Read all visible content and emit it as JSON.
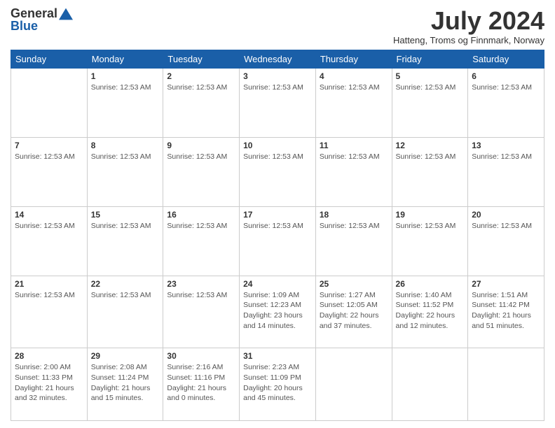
{
  "logo": {
    "line1": "General",
    "line2": "Blue"
  },
  "title": "July 2024",
  "location": "Hatteng, Troms og Finnmark, Norway",
  "days_of_week": [
    "Sunday",
    "Monday",
    "Tuesday",
    "Wednesday",
    "Thursday",
    "Friday",
    "Saturday"
  ],
  "weeks": [
    [
      {
        "day": "",
        "info": ""
      },
      {
        "day": "1",
        "info": "Sunrise: 12:53 AM"
      },
      {
        "day": "2",
        "info": "Sunrise: 12:53 AM"
      },
      {
        "day": "3",
        "info": "Sunrise: 12:53 AM"
      },
      {
        "day": "4",
        "info": "Sunrise: 12:53 AM"
      },
      {
        "day": "5",
        "info": "Sunrise: 12:53 AM"
      },
      {
        "day": "6",
        "info": "Sunrise: 12:53 AM"
      }
    ],
    [
      {
        "day": "7",
        "info": "Sunrise: 12:53 AM"
      },
      {
        "day": "8",
        "info": "Sunrise: 12:53 AM"
      },
      {
        "day": "9",
        "info": "Sunrise: 12:53 AM"
      },
      {
        "day": "10",
        "info": "Sunrise: 12:53 AM"
      },
      {
        "day": "11",
        "info": "Sunrise: 12:53 AM"
      },
      {
        "day": "12",
        "info": "Sunrise: 12:53 AM"
      },
      {
        "day": "13",
        "info": "Sunrise: 12:53 AM"
      }
    ],
    [
      {
        "day": "14",
        "info": "Sunrise: 12:53 AM"
      },
      {
        "day": "15",
        "info": "Sunrise: 12:53 AM"
      },
      {
        "day": "16",
        "info": "Sunrise: 12:53 AM"
      },
      {
        "day": "17",
        "info": "Sunrise: 12:53 AM"
      },
      {
        "day": "18",
        "info": "Sunrise: 12:53 AM"
      },
      {
        "day": "19",
        "info": "Sunrise: 12:53 AM"
      },
      {
        "day": "20",
        "info": "Sunrise: 12:53 AM"
      }
    ],
    [
      {
        "day": "21",
        "info": "Sunrise: 12:53 AM"
      },
      {
        "day": "22",
        "info": "Sunrise: 12:53 AM"
      },
      {
        "day": "23",
        "info": "Sunrise: 12:53 AM"
      },
      {
        "day": "24",
        "info": "Sunrise: 1:09 AM\nSunset: 12:23 AM\nDaylight: 23 hours and 14 minutes."
      },
      {
        "day": "25",
        "info": "Sunrise: 1:27 AM\nSunset: 12:05 AM\nDaylight: 22 hours and 37 minutes."
      },
      {
        "day": "26",
        "info": "Sunrise: 1:40 AM\nSunset: 11:52 PM\nDaylight: 22 hours and 12 minutes."
      },
      {
        "day": "27",
        "info": "Sunrise: 1:51 AM\nSunset: 11:42 PM\nDaylight: 21 hours and 51 minutes."
      }
    ],
    [
      {
        "day": "28",
        "info": "Sunrise: 2:00 AM\nSunset: 11:33 PM\nDaylight: 21 hours and 32 minutes."
      },
      {
        "day": "29",
        "info": "Sunrise: 2:08 AM\nSunset: 11:24 PM\nDaylight: 21 hours and 15 minutes."
      },
      {
        "day": "30",
        "info": "Sunrise: 2:16 AM\nSunset: 11:16 PM\nDaylight: 21 hours and 0 minutes."
      },
      {
        "day": "31",
        "info": "Sunrise: 2:23 AM\nSunset: 11:09 PM\nDaylight: 20 hours and 45 minutes."
      },
      {
        "day": "",
        "info": ""
      },
      {
        "day": "",
        "info": ""
      },
      {
        "day": "",
        "info": ""
      }
    ]
  ]
}
